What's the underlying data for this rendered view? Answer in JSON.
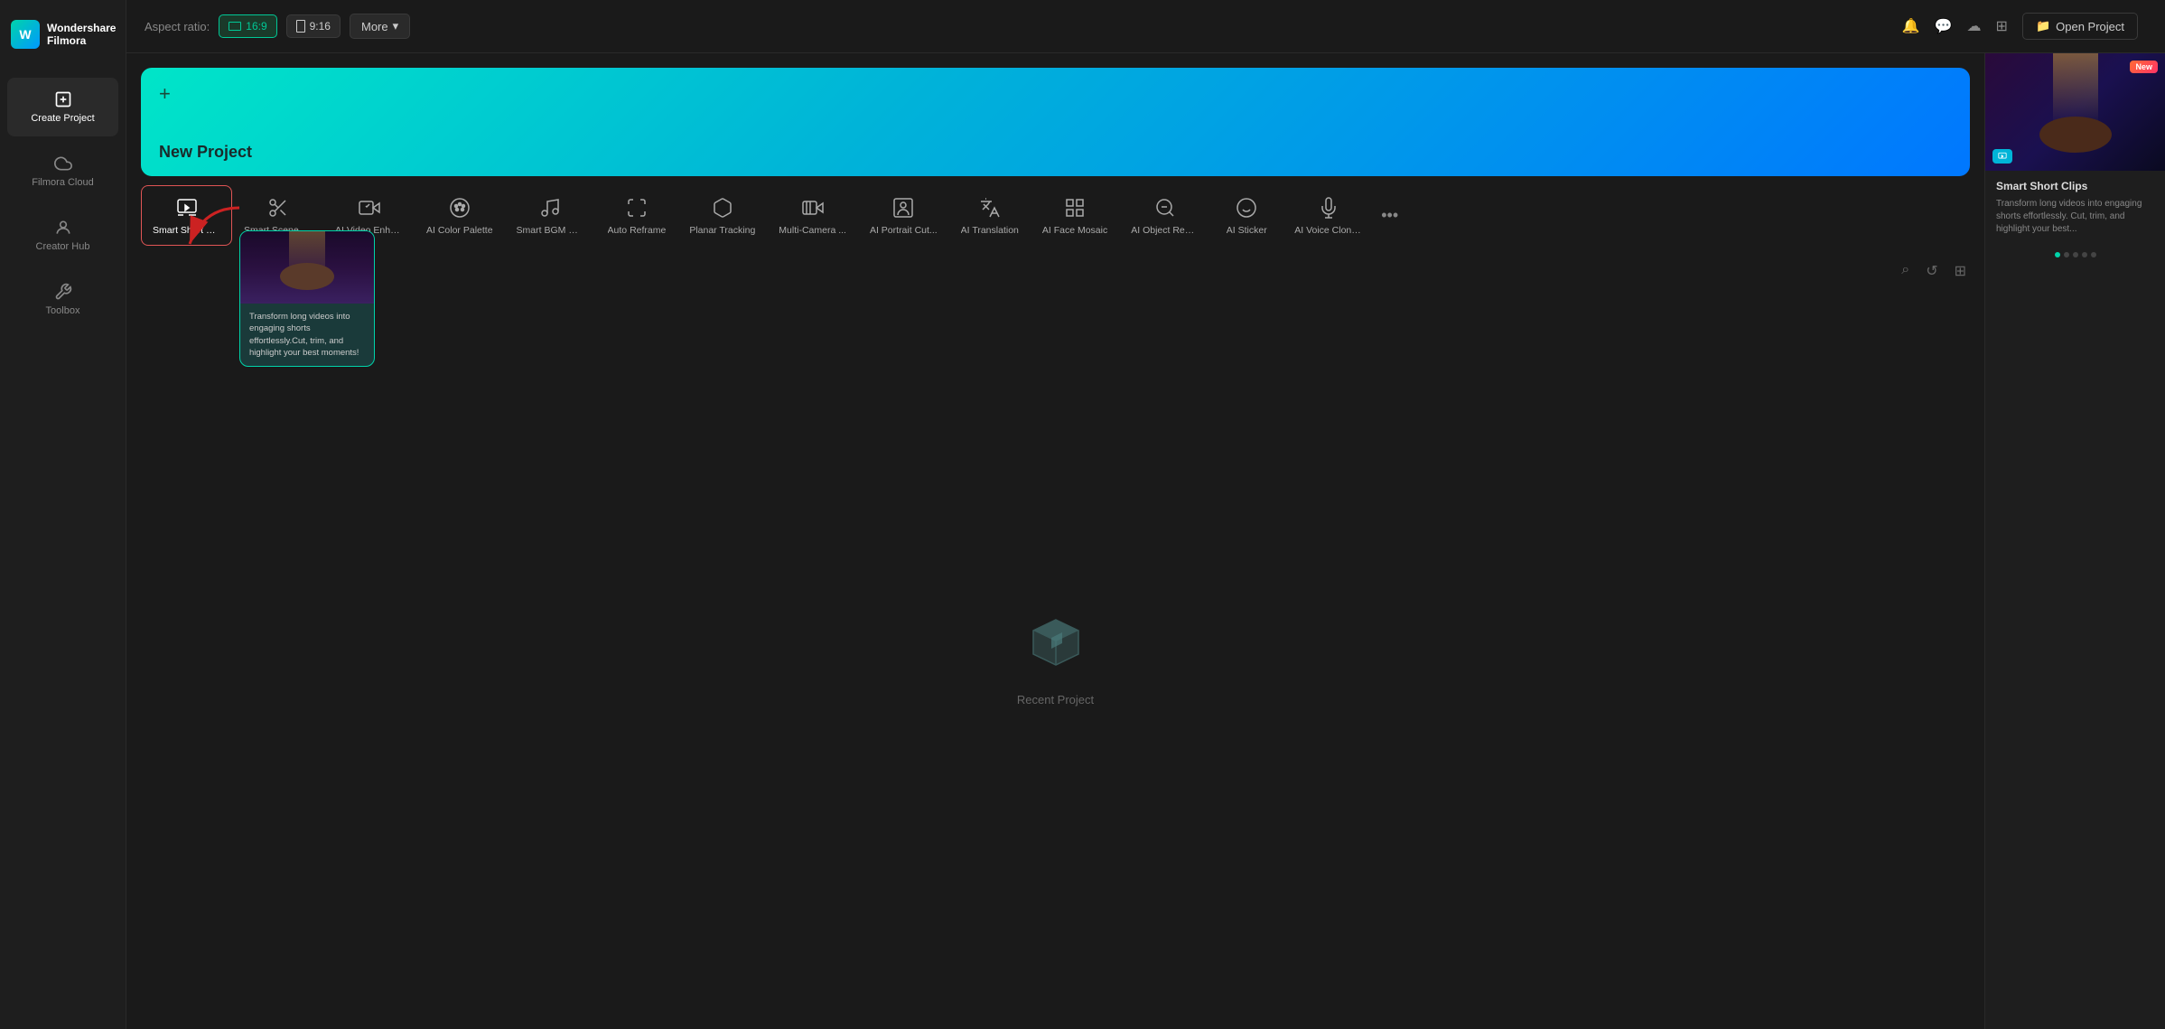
{
  "app": {
    "name": "Wondershare",
    "sub": "Filmora"
  },
  "sidebar": {
    "items": [
      {
        "id": "create-project",
        "label": "Create Project",
        "active": true
      },
      {
        "id": "filmora-cloud",
        "label": "Filmora Cloud",
        "active": false
      },
      {
        "id": "creator-hub",
        "label": "Creator Hub",
        "active": false
      },
      {
        "id": "toolbox",
        "label": "Toolbox",
        "active": false
      }
    ]
  },
  "topbar": {
    "aspect_label": "Aspect ratio:",
    "aspect_options": [
      {
        "id": "16-9",
        "label": "16:9",
        "selected": true
      },
      {
        "id": "9-16",
        "label": "9:16",
        "selected": false
      }
    ],
    "more_label": "More",
    "open_project_label": "Open Project"
  },
  "banner": {
    "title": "New Project"
  },
  "features": [
    {
      "id": "smart-short-clips",
      "label": "Smart Short Cli...",
      "active": true
    },
    {
      "id": "smart-scene-cut",
      "label": "Smart Scene Cut",
      "active": false
    },
    {
      "id": "ai-video-enhance",
      "label": "AI Video Enhan...",
      "active": false
    },
    {
      "id": "ai-color-palette",
      "label": "AI Color Palette",
      "active": false
    },
    {
      "id": "smart-bgm-generate",
      "label": "Smart BGM Ge...",
      "active": false
    },
    {
      "id": "auto-reframe",
      "label": "Auto Reframe",
      "active": false
    },
    {
      "id": "planar-tracking",
      "label": "Planar Tracking",
      "active": false
    },
    {
      "id": "multi-camera",
      "label": "Multi-Camera ...",
      "active": false
    },
    {
      "id": "ai-portrait-cut",
      "label": "AI Portrait Cut...",
      "active": false
    },
    {
      "id": "ai-translation",
      "label": "AI Translation",
      "active": false
    },
    {
      "id": "ai-face-mosaic",
      "label": "AI Face Mosaic",
      "active": false
    },
    {
      "id": "ai-object-remove",
      "label": "AI Object Rem...",
      "active": false
    },
    {
      "id": "ai-sticker",
      "label": "AI Sticker",
      "active": false
    },
    {
      "id": "ai-voice-cloning",
      "label": "AI Voice Cloning",
      "active": false
    }
  ],
  "tooltip": {
    "text": "Transform long videos into engaging shorts effortlessly.Cut, trim, and highlight your best moments!"
  },
  "right_panel": {
    "badge": "New",
    "title": "Smart Short Clips",
    "description": "Transform long videos into engaging shorts effortlessly. Cut, trim, and highlight your best...",
    "label_icon": "Smart Short Clips"
  },
  "empty_state": {
    "text": "Recent Project"
  },
  "project_controls": {
    "search": "⌕",
    "refresh": "↺",
    "grid": "⊞"
  }
}
